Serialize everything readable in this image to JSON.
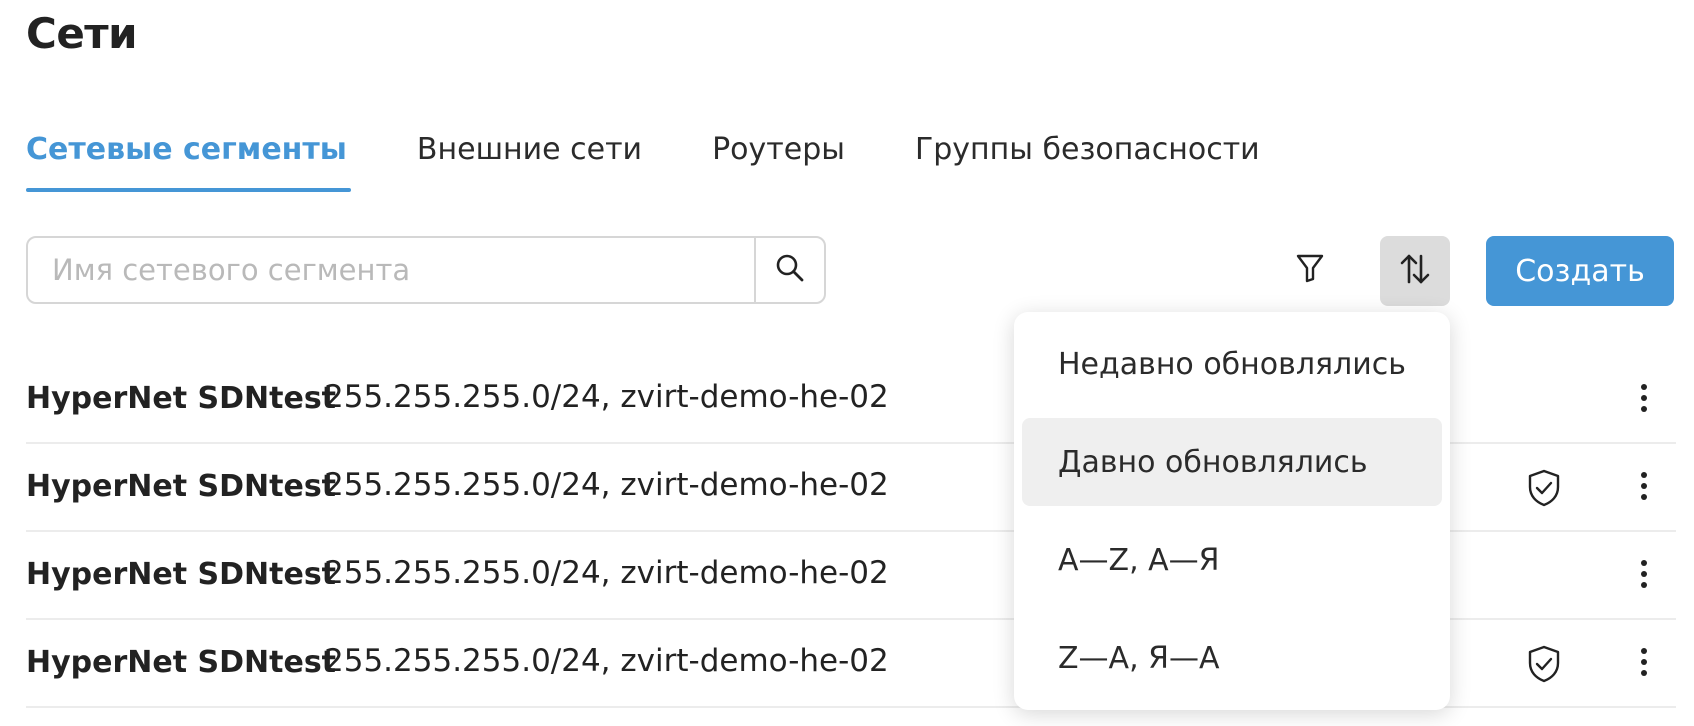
{
  "page": {
    "title": "Сети"
  },
  "tabs": [
    {
      "label": "Сетевые сегменты",
      "active": true
    },
    {
      "label": "Внешние сети",
      "active": false
    },
    {
      "label": "Роутеры",
      "active": false
    },
    {
      "label": "Группы безопасности",
      "active": false
    }
  ],
  "toolbar": {
    "search_placeholder": "Имя сетевого сегмента",
    "search_value": "",
    "create_label": "Создать",
    "icons": {
      "search": "search-icon",
      "filter": "filter-icon",
      "sort": "sort-icon"
    }
  },
  "sort_menu": {
    "items": [
      {
        "label": "Недавно обновлялись",
        "selected": false
      },
      {
        "label": "Давно обновлялись",
        "selected": true
      },
      {
        "label": "A—Z, А—Я",
        "selected": false
      },
      {
        "label": "Z—A, Я—А",
        "selected": false
      }
    ]
  },
  "rows": [
    {
      "name": "HyperNet SDNtest",
      "description": "255.255.255.0/24, zvirt-demo-he-02",
      "shield": false
    },
    {
      "name": "HyperNet SDNtest",
      "description": "255.255.255.0/24, zvirt-demo-he-02",
      "shield": true
    },
    {
      "name": "HyperNet SDNtest",
      "description": "255.255.255.0/24, zvirt-demo-he-02",
      "shield": false
    },
    {
      "name": "HyperNet SDNtest",
      "description": "255.255.255.0/24, zvirt-demo-he-02",
      "shield": true
    }
  ],
  "colors": {
    "accent": "#4596d6",
    "text": "#222222",
    "sort_active_bg": "#dcdcdc",
    "menu_selected_bg": "#efefef"
  }
}
